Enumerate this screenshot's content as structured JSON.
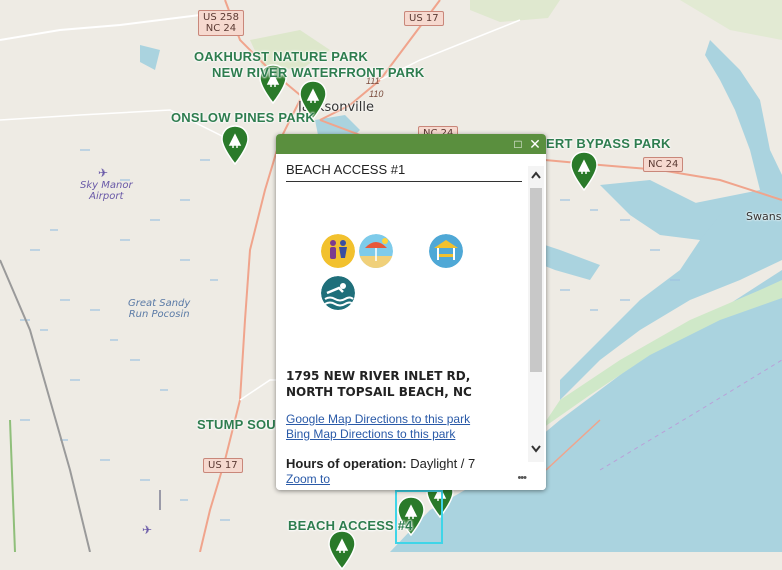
{
  "map": {
    "parks": [
      {
        "label": "OAKHURST NATURE PARK"
      },
      {
        "label": "NEW RIVER WATERFRONT PARK"
      },
      {
        "label": "ONSLOW PINES PARK"
      },
      {
        "label": "ERT BYPASS PARK"
      },
      {
        "label": "STUMP SOU"
      },
      {
        "label": "BEACH ACCESS #4"
      }
    ],
    "city_label": "Jacksonville",
    "town_label": "Swans",
    "places": {
      "airport_line1": "Sky Manor",
      "airport_line2": "Airport",
      "pocosin_line1": "Great Sandy",
      "pocosin_line2": "Run Pocosin"
    },
    "road_shields": {
      "us258": "US 258",
      "nc24_top": "NC 24",
      "us17_top": "US 17",
      "nc24_mid": "NC 24",
      "nc24_right": "NC 24",
      "us17_bottom": "US 17",
      "r111": "111",
      "r110": "110"
    },
    "colors": {
      "land": "#eeebe4",
      "water": "#aad3df",
      "pin_green": "#2a7a2a",
      "park_label": "#2e7d4f",
      "popup_header": "#5a8f3e"
    }
  },
  "popup": {
    "title": "BEACH ACCESS #1",
    "amenity_icons": [
      "restroom-icon",
      "beach-icon",
      "picnic-shelter-icon",
      "swimming-icon"
    ],
    "address_line1": "1795 NEW RIVER INLET RD,",
    "address_line2": "NORTH TOPSAIL BEACH, NC",
    "google_link": "Google Map Directions to this park",
    "bing_link": "Bing Map Directions to this park",
    "hours_label": "Hours of operation:",
    "hours_value": " Daylight / 7",
    "zoom_link": "Zoom to",
    "more_label": "•••",
    "maximize_label": "□",
    "close_label": "✕"
  }
}
